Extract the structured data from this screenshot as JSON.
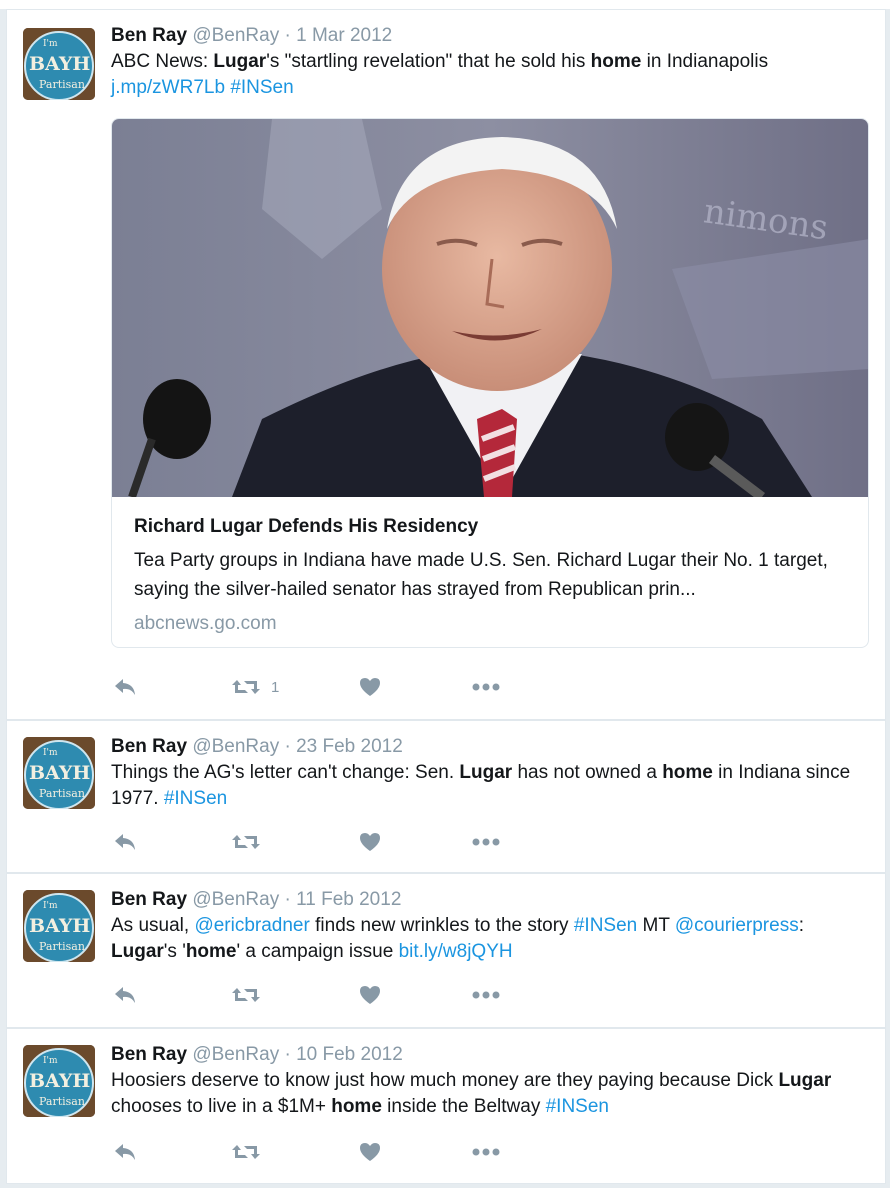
{
  "colors": {
    "link": "#1b95e0",
    "muted": "#8899a6",
    "text": "#14171a",
    "border": "#e1e8ed"
  },
  "avatar": {
    "line1": "I'm",
    "line2": "BAYH",
    "line3": "Partisan"
  },
  "tweets": [
    {
      "fullname": "Ben Ray",
      "handle": "@BenRay",
      "sep": "·",
      "time": "1 Mar 2012",
      "text_parts": [
        {
          "t": "ABC News:  ",
          "s": "plain"
        },
        {
          "t": "Lugar",
          "s": "bold"
        },
        {
          "t": "'s \"startling revelation\" that he sold his ",
          "s": "plain"
        },
        {
          "t": "home",
          "s": "bold"
        },
        {
          "t": " in Indianapolis ",
          "s": "plain"
        },
        {
          "t": "j.mp/zWR7Lb",
          "s": "link"
        },
        {
          "t": " ",
          "s": "plain"
        },
        {
          "t": "#INSen",
          "s": "link"
        }
      ],
      "card": {
        "title": "Richard Lugar Defends His Residency",
        "description": "Tea Party groups in Indiana have made U.S. Sen. Richard Lugar their No. 1 target, saying the silver-hailed senator has strayed from Republican prin...",
        "domain": "abcnews.go.com",
        "backdrop_text": "nimons"
      },
      "actions": {
        "reply_icon": "reply-icon",
        "retweet_icon": "retweet-icon",
        "retweet_count": "1",
        "like_icon": "heart-icon",
        "more_icon": "more-icon"
      }
    },
    {
      "fullname": "Ben Ray",
      "handle": "@BenRay",
      "sep": "·",
      "time": "23 Feb 2012",
      "text_parts": [
        {
          "t": "Things the AG's letter can't change:  Sen. ",
          "s": "plain"
        },
        {
          "t": "Lugar",
          "s": "bold"
        },
        {
          "t": " has not owned a ",
          "s": "plain"
        },
        {
          "t": "home",
          "s": "bold"
        },
        {
          "t": " in Indiana since 1977. ",
          "s": "plain"
        },
        {
          "t": "#INSen",
          "s": "link"
        }
      ],
      "actions": {
        "retweet_count": ""
      }
    },
    {
      "fullname": "Ben Ray",
      "handle": "@BenRay",
      "sep": "·",
      "time": "11 Feb 2012",
      "text_parts": [
        {
          "t": "As usual, ",
          "s": "plain"
        },
        {
          "t": "@ericbradner",
          "s": "link"
        },
        {
          "t": " finds new wrinkles to the story ",
          "s": "plain"
        },
        {
          "t": "#INSen",
          "s": "link"
        },
        {
          "t": " MT ",
          "s": "plain"
        },
        {
          "t": "@courierpress",
          "s": "link"
        },
        {
          "t": ": ",
          "s": "plain"
        },
        {
          "t": "Lugar",
          "s": "bold"
        },
        {
          "t": "'s '",
          "s": "plain"
        },
        {
          "t": "home",
          "s": "bold"
        },
        {
          "t": "' a campaign issue ",
          "s": "plain"
        },
        {
          "t": "bit.ly/w8jQYH",
          "s": "link"
        }
      ],
      "actions": {
        "retweet_count": ""
      }
    },
    {
      "fullname": "Ben Ray",
      "handle": "@BenRay",
      "sep": "·",
      "time": "10 Feb 2012",
      "text_parts": [
        {
          "t": "Hoosiers deserve to know just how much money are they paying because Dick ",
          "s": "plain"
        },
        {
          "t": "Lugar",
          "s": "bold"
        },
        {
          "t": " chooses to live in a $1M+ ",
          "s": "plain"
        },
        {
          "t": "home",
          "s": "bold"
        },
        {
          "t": " inside the Beltway ",
          "s": "plain"
        },
        {
          "t": "#INSen",
          "s": "link"
        }
      ],
      "actions": {
        "retweet_count": ""
      }
    }
  ]
}
